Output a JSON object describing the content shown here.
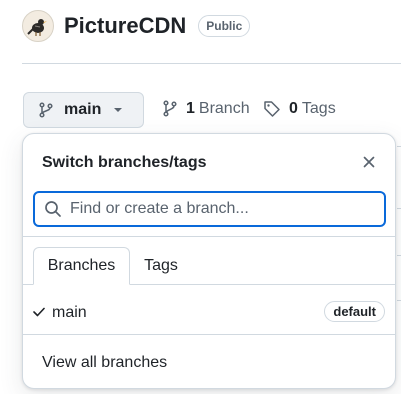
{
  "repo": {
    "name": "PictureCDN",
    "visibility": "Public"
  },
  "branch_button": {
    "label": "main",
    "icon": "git-branch-icon"
  },
  "meta": {
    "branch_count": "1",
    "branch_label": "Branch",
    "tag_count": "0",
    "tag_label": "Tags"
  },
  "popover": {
    "title": "Switch branches/tags",
    "search_placeholder": "Find or create a branch...",
    "tabs": [
      "Branches",
      "Tags"
    ],
    "active_tab": "Branches",
    "branches": [
      {
        "name": "main",
        "selected": true,
        "badge": "default"
      }
    ],
    "view_all": "View all branches"
  },
  "colors": {
    "accent": "#0969da",
    "border": "#d1d9e0",
    "muted": "#59636e",
    "button_bg": "#eff2f5"
  }
}
